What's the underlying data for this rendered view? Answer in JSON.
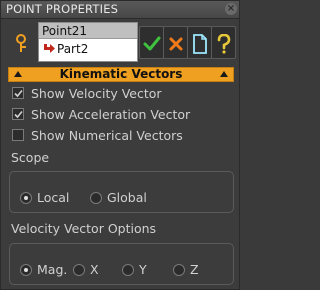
{
  "window": {
    "title": "POINT PROPERTIES",
    "close_label": "×"
  },
  "tree": {
    "items": [
      {
        "label": "Point21",
        "selected": true
      },
      {
        "label": "Part2",
        "icon": "red-arrow-icon"
      }
    ]
  },
  "toolbar": {
    "buttons": [
      {
        "name": "apply-button",
        "icon": "checkmark-icon",
        "color": "#3fc23f"
      },
      {
        "name": "cancel-button",
        "icon": "x-icon",
        "color": "#f07a1a"
      },
      {
        "name": "new-button",
        "icon": "document-icon",
        "color": "#9ee8ff"
      },
      {
        "name": "help-button",
        "icon": "question-icon",
        "color": "#e6c83a"
      }
    ]
  },
  "section": {
    "title": "Kinematic Vectors",
    "color": "#f0a020"
  },
  "options": [
    {
      "label": "Show Velocity Vector",
      "checked": true
    },
    {
      "label": "Show Acceleration Vector",
      "checked": true
    },
    {
      "label": "Show Numerical Vectors",
      "checked": false
    }
  ],
  "scope": {
    "heading": "Scope",
    "options": [
      {
        "label": "Local",
        "selected": true
      },
      {
        "label": "Global",
        "selected": false
      }
    ]
  },
  "velocity_options": {
    "heading": "Velocity Vector Options",
    "options": [
      {
        "label": "Mag.",
        "selected": true
      },
      {
        "label": "X",
        "selected": false
      },
      {
        "label": "Y",
        "selected": false
      },
      {
        "label": "Z",
        "selected": false
      }
    ]
  }
}
